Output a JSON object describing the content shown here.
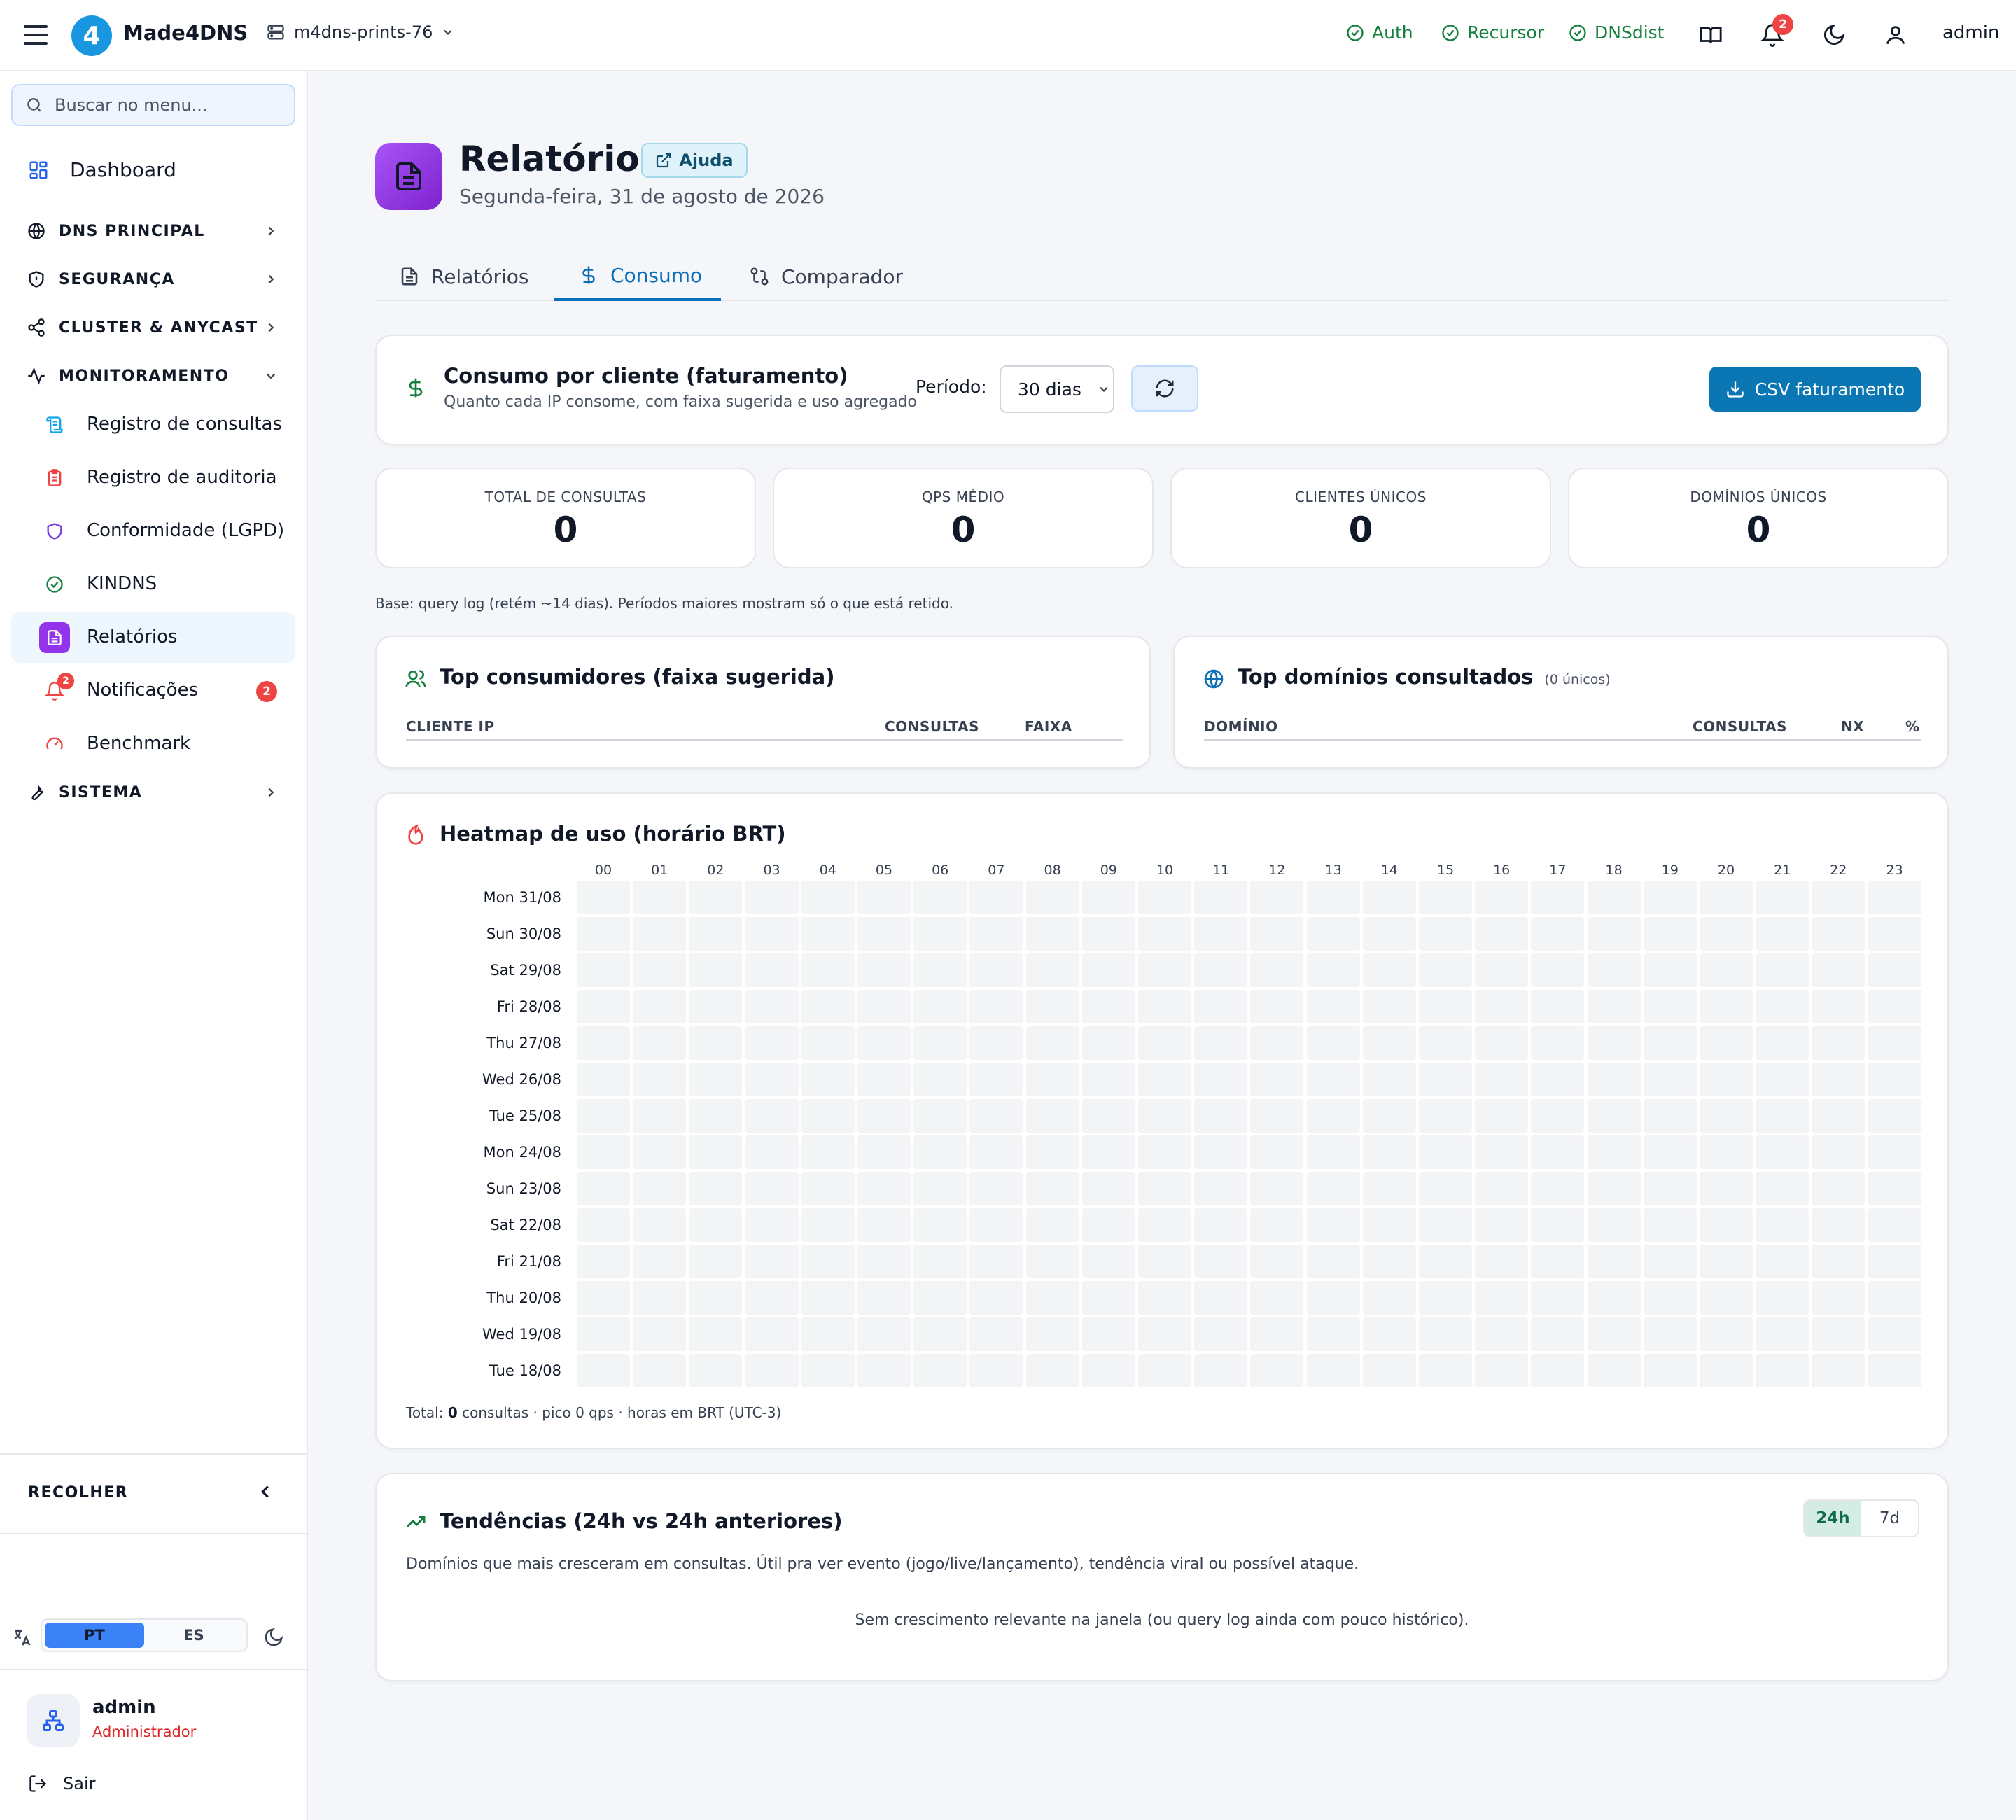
{
  "topbar": {
    "brand": "Made4DNS",
    "logo_glyph": "4",
    "server": "m4dns-prints-76",
    "status": [
      {
        "label": "Auth"
      },
      {
        "label": "Recursor"
      },
      {
        "label": "DNSdist"
      }
    ],
    "notifications_count": "2",
    "user": "admin",
    "status_color": "#15803d"
  },
  "sidebar": {
    "search_placeholder": "Buscar no menu...",
    "dashboard": "Dashboard",
    "sections": {
      "dns": "DNS PRINCIPAL",
      "security": "SEGURANÇA",
      "cluster": "CLUSTER & ANYCAST",
      "monitoring": "MONITORAMENTO",
      "system": "SISTEMA"
    },
    "monitoring_items": {
      "query_log": "Registro de consultas",
      "audit_log": "Registro de auditoria",
      "lgpd": "Conformidade (LGPD)",
      "kindns": "KINDNS",
      "reports": "Relatórios",
      "notifications": "Notificações",
      "notifications_badge": "2",
      "benchmark": "Benchmark"
    },
    "collapse": "RECOLHER",
    "languages": {
      "pt": "PT",
      "es": "ES",
      "selected": "PT"
    },
    "user_name": "admin",
    "user_role": "Administrador",
    "logout": "Sair"
  },
  "page": {
    "title": "Relatórios",
    "help": "Ajuda",
    "date": "Segunda-feira, 31 de agosto de 2026",
    "accent": "#9333ea"
  },
  "tabs": {
    "reports": "Relatórios",
    "consumption": "Consumo",
    "comparator": "Comparador",
    "active": "Consumo"
  },
  "consumption": {
    "title": "Consumo por cliente (faturamento)",
    "subtitle": "Quanto cada IP consome, com faixa sugerida e uso agregado",
    "period_label": "Período:",
    "period_value": "30 dias",
    "csv_button": "CSV faturamento"
  },
  "stats": {
    "total": {
      "label": "TOTAL DE CONSULTAS",
      "value": "0"
    },
    "qps": {
      "label": "QPS MÉDIO",
      "value": "0"
    },
    "clients": {
      "label": "CLIENTES ÚNICOS",
      "value": "0"
    },
    "domains": {
      "label": "DOMÍNIOS ÚNICOS",
      "value": "0"
    }
  },
  "base_note": "Base: query log (retém ~14 dias). Períodos maiores mostram só o que está retido.",
  "top_consumers": {
    "title": "Top consumidores (faixa sugerida)",
    "columns": {
      "ip": "CLIENTE IP",
      "queries": "CONSULTAS",
      "band": "FAIXA"
    }
  },
  "top_domains": {
    "title": "Top domínios consultados",
    "unique_note": "(0 únicos)",
    "columns": {
      "domain": "DOMÍNIO",
      "queries": "CONSULTAS",
      "nx": "NX",
      "pct": "%"
    }
  },
  "heatmap": {
    "title": "Heatmap de uso (horário BRT)",
    "hours": [
      "00",
      "01",
      "02",
      "03",
      "04",
      "05",
      "06",
      "07",
      "08",
      "09",
      "10",
      "11",
      "12",
      "13",
      "14",
      "15",
      "16",
      "17",
      "18",
      "19",
      "20",
      "21",
      "22",
      "23"
    ],
    "days": [
      "Mon 31/08",
      "Sun 30/08",
      "Sat 29/08",
      "Fri 28/08",
      "Thu 27/08",
      "Wed 26/08",
      "Tue 25/08",
      "Mon 24/08",
      "Sun 23/08",
      "Sat 22/08",
      "Fri 21/08",
      "Thu 20/08",
      "Wed 19/08",
      "Tue 18/08"
    ],
    "footer_prefix": "Total: ",
    "footer_total": "0",
    "footer_suffix": " consultas · pico 0 qps · horas em BRT (UTC-3)"
  },
  "trends": {
    "title": "Tendências (24h vs 24h anteriores)",
    "description": "Domínios que mais cresceram em consultas. Útil pra ver evento (jogo/live/lançamento), tendência viral ou possível ataque.",
    "empty": "Sem crescimento relevante na janela (ou query log ainda com pouco histórico).",
    "windows": {
      "a": "24h",
      "b": "7d",
      "selected": "24h"
    }
  },
  "icons": [
    "menu-icon",
    "server-icon",
    "check-circle-icon",
    "book-icon",
    "bell-icon",
    "moon-icon",
    "user-icon",
    "search-icon",
    "grid-icon",
    "globe-icon",
    "shield-icon",
    "share-icon",
    "activity-icon",
    "scroll-icon",
    "clipboard-icon",
    "kindns-check-icon",
    "report-icon",
    "gauge-icon",
    "wrench-icon",
    "translate-icon",
    "logout-icon",
    "dollar-icon",
    "compare-icon",
    "refresh-icon",
    "download-icon",
    "users-icon",
    "flame-icon",
    "trending-up-icon",
    "external-link-icon"
  ]
}
